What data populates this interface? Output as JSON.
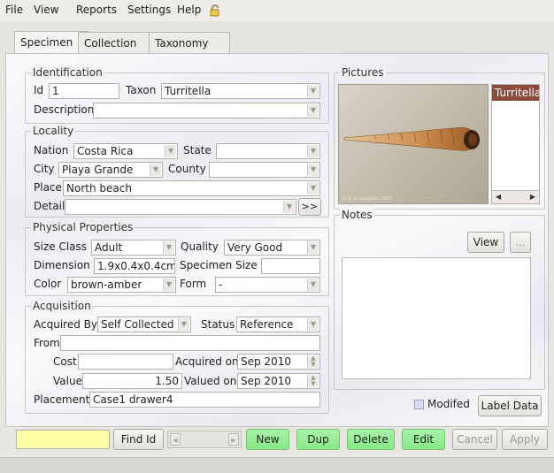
{
  "menu": {
    "items": [
      "File",
      "View",
      "Reports",
      "Settings",
      "Help"
    ],
    "lock_icon": "lock-icon"
  },
  "tabs": [
    "Specimen",
    "Collection",
    "Taxonomy"
  ],
  "identification": {
    "legend": "Identification",
    "id_label": "Id",
    "id_value": "1",
    "taxon_label": "Taxon",
    "taxon_value": "Turritella",
    "description_label": "Description",
    "description_value": ""
  },
  "locality": {
    "legend": "Locality",
    "nation_label": "Nation",
    "nation_value": "Costa Rica",
    "state_label": "State",
    "state_value": "",
    "city_label": "City",
    "city_value": "Playa Grande",
    "county_label": "County",
    "county_value": "",
    "place_label": "Place",
    "place_value": "North beach",
    "detail_label": "Detail",
    "detail_value": "",
    "more_button": ">>"
  },
  "physical": {
    "legend": "Physical Properties",
    "size_class_label": "Size Class",
    "size_class_value": "Adult",
    "quality_label": "Quality",
    "quality_value": "Very Good",
    "dimension_label": "Dimension",
    "dimension_value": "1.9x0.4x0.4cm",
    "specimen_size_label": "Specimen Size",
    "specimen_size_value": "",
    "color_label": "Color",
    "color_value": "brown-amber",
    "form_label": "Form",
    "form_value": "-"
  },
  "acquisition": {
    "legend": "Acquisition",
    "acquired_by_label": "Acquired By",
    "acquired_by_value": "Self Collected",
    "status_label": "Status",
    "status_value": "Reference",
    "from_label": "From",
    "from_value": "",
    "cost_label": "Cost",
    "cost_value": "",
    "acquired_on_label": "Acquired on",
    "acquired_on_value": "Sep 2010",
    "value_label": "Value",
    "value_value": "1.50",
    "valued_on_label": "Valued on",
    "valued_on_value": "Sep 2010",
    "placement_label": "Placement",
    "placement_value": "Case1 drawer4"
  },
  "pictures": {
    "legend": "Pictures",
    "list_items": [
      "Turritella"
    ],
    "copyright": "© k. e. vaughan, 2007"
  },
  "notes": {
    "legend": "Notes",
    "view_button": "View",
    "more_button": "...",
    "content": "",
    "modified_label": "Modifed",
    "label_data_button": "Label Data"
  },
  "bottom": {
    "find_input": "",
    "find_button": "Find Id",
    "new_button": "New",
    "dup_button": "Dup",
    "delete_button": "Delete",
    "edit_button": "Edit",
    "cancel_button": "Cancel",
    "apply_button": "Apply"
  },
  "colors": {
    "green_button": "#8de88d",
    "find_input_bg": "#ffffa8",
    "picture_list_selected": "#8b4a3a"
  }
}
